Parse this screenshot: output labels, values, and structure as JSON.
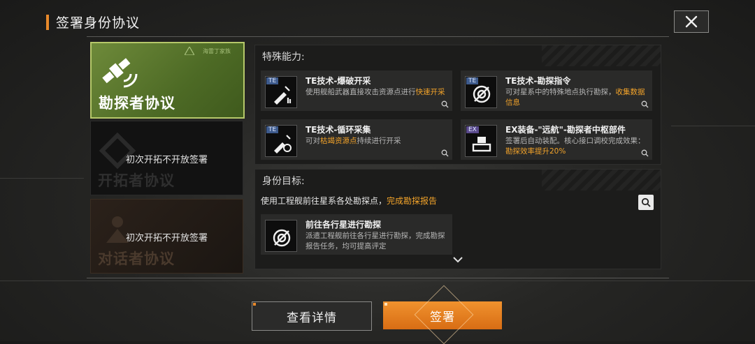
{
  "header": {
    "title": "签署身份协议"
  },
  "cards": [
    {
      "label": "勘探者协议",
      "badge": "海雷丁家族",
      "state": "active"
    },
    {
      "label": "开拓者协议",
      "lock_text": "初次开拓不开放签署",
      "state": "locked"
    },
    {
      "label": "对话者协议",
      "lock_text": "初次开拓不开放签署",
      "state": "locked"
    }
  ],
  "abilities_section": {
    "title": "特殊能力:",
    "items": [
      {
        "tag": "TE",
        "title": "TE技术-爆破开采",
        "desc_pre": "使用舰船武器直接攻击资源点进行",
        "desc_hl": "快速开采",
        "desc_post": "",
        "icon": "blasting-icon"
      },
      {
        "tag": "TE",
        "title": "TE技术-勘探指令",
        "desc_pre": "可对星系中的特殊地点执行勘探，",
        "desc_hl": "收集数据信息",
        "desc_post": "",
        "icon": "radar-icon"
      },
      {
        "tag": "TE",
        "title": "TE技术-循环采集",
        "desc_pre": "可对",
        "desc_hl": "枯竭资源点",
        "desc_post": "持续进行开采",
        "icon": "cycle-mining-icon"
      },
      {
        "tag": "EX",
        "title": "EX装备-\"远航\"-勘探者中枢部件",
        "desc_pre": "签署后自动装配。核心接口调校完成效果：",
        "desc_hl": "勘探效率提升20%",
        "desc_post": "",
        "icon": "equipment-icon"
      }
    ]
  },
  "goal_section": {
    "title": "身份目标:",
    "goal_pre": "使用工程舰前往星系各处勘探点，",
    "goal_hl": "完成勘探报告",
    "task": {
      "title": "前往各行星进行勘探",
      "desc": "派遣工程舰前往各行星进行勘探，完成勘探报告任务，均可提高评定"
    }
  },
  "buttons": {
    "detail": "查看详情",
    "sign": "签署"
  },
  "colors": {
    "accent": "#e8892a",
    "highlight": "#f2a32a",
    "active_card": "#5a7a2d"
  }
}
